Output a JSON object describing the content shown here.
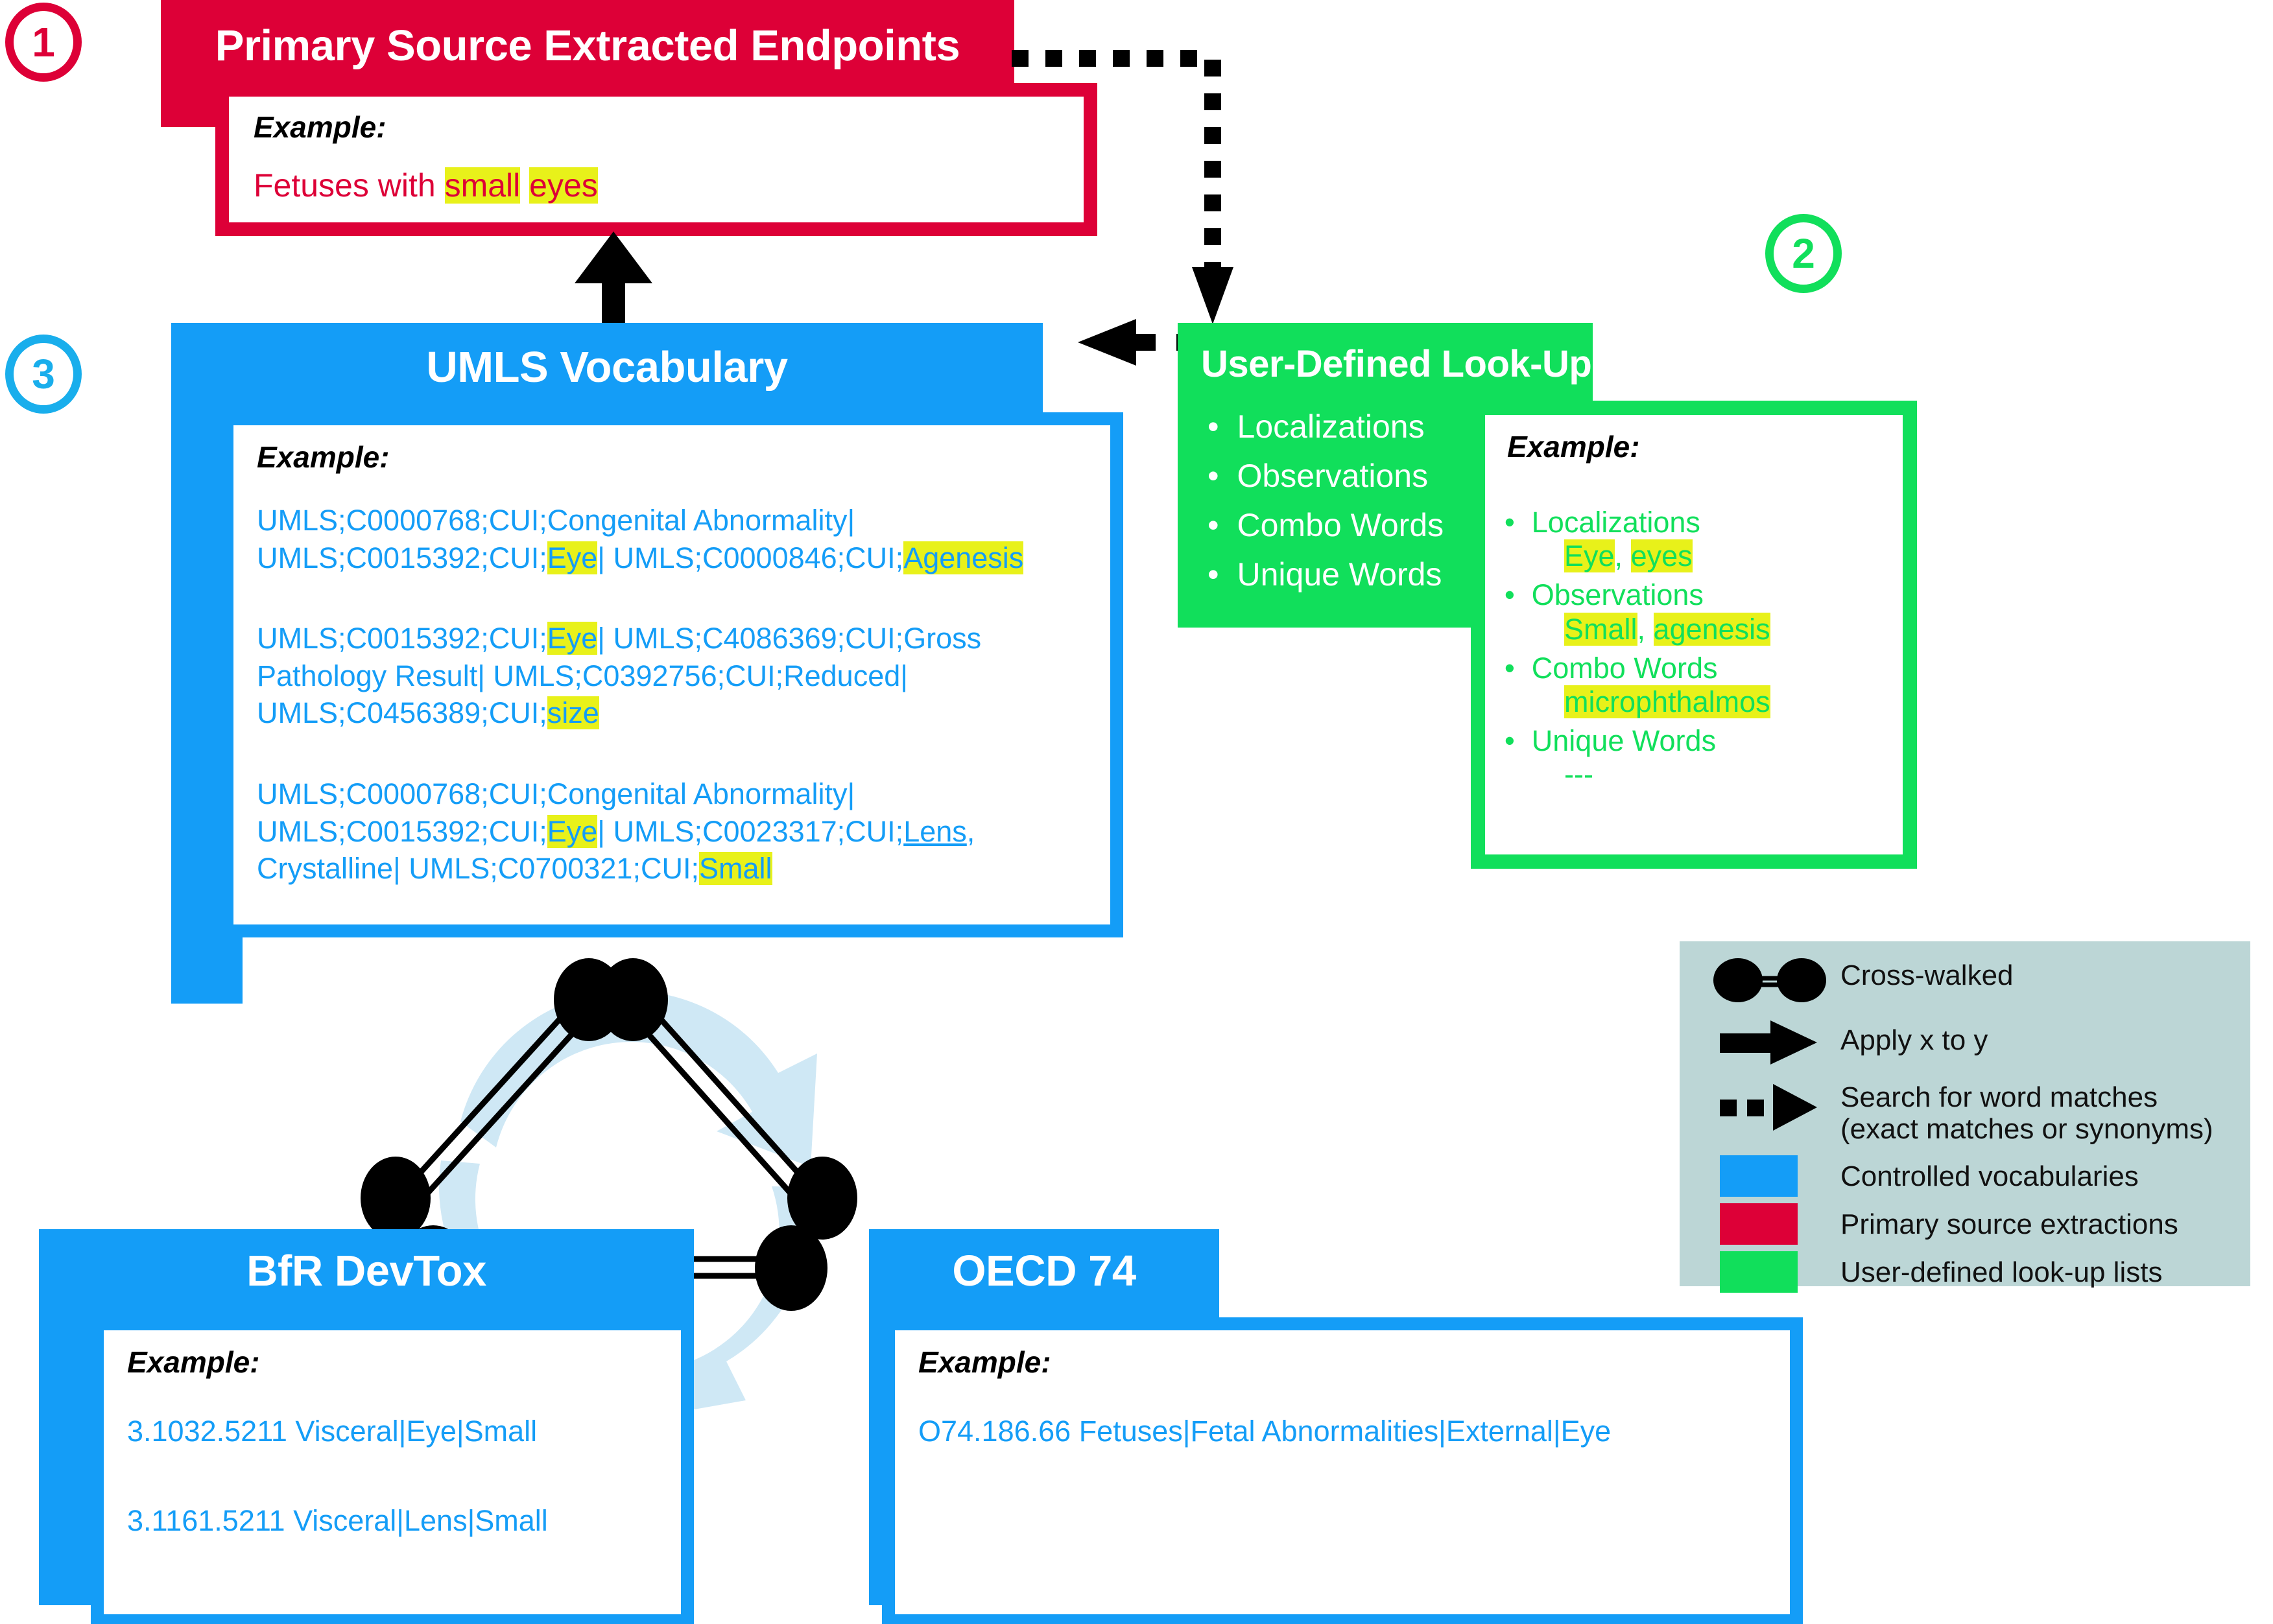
{
  "steps": [
    {
      "num": "1",
      "color": "#DD0037"
    },
    {
      "num": "2",
      "color": "#11DF5B"
    },
    {
      "num": "3",
      "color": "#19AEEC"
    }
  ],
  "colors": {
    "red": "#DD0037",
    "blue": "#149DF7",
    "green": "#11DF5B",
    "highlight": "#E8F11A",
    "legend_bg": "#BCD6D6",
    "cycle_arrow": "#CFE8F5",
    "black": "#000000",
    "white": "#FFFFFF"
  },
  "primary_source": {
    "title": "Primary Source Extracted Endpoints",
    "example_label": "Example:",
    "example_parts": [
      {
        "text": "Fetuses with ",
        "highlight": false
      },
      {
        "text": "small",
        "highlight": true
      },
      {
        "text": " ",
        "highlight": false
      },
      {
        "text": "eyes",
        "highlight": true
      }
    ]
  },
  "umls": {
    "title": "UMLS Vocabulary",
    "example_label": "Example:",
    "entries": [
      [
        {
          "text": "UMLS;C0000768;CUI;Congenital Abnormality| UMLS;C0015392;CUI;",
          "highlight": false
        },
        {
          "text": "Eye",
          "highlight": true
        },
        {
          "text": "| UMLS;C0000846;CUI;",
          "highlight": false
        },
        {
          "text": "Agenesis",
          "highlight": true
        }
      ],
      [
        {
          "text": "UMLS;C0015392;CUI;",
          "highlight": false
        },
        {
          "text": "Eye",
          "highlight": true
        },
        {
          "text": "| UMLS;C4086369;CUI;Gross Pathology Result| UMLS;C0392756;CUI;Reduced| UMLS;C0456389;CUI;",
          "highlight": false
        },
        {
          "text": "size",
          "highlight": true
        }
      ],
      [
        {
          "text": "UMLS;C0000768;CUI;Congenital Abnormality| UMLS;C0015392;CUI;",
          "highlight": false
        },
        {
          "text": "Eye",
          "highlight": true
        },
        {
          "text": "| UMLS;C0023317;CUI;",
          "highlight": false
        },
        {
          "text": "Lens",
          "highlight": false,
          "underline": true
        },
        {
          "text": ", Crystalline| UMLS;C0700321;CUI;",
          "highlight": false
        },
        {
          "text": "Small",
          "highlight": true
        }
      ]
    ]
  },
  "lookup": {
    "title": "User-Defined Look-Up Lists:",
    "bullets": [
      "Localizations",
      "Observations",
      "Combo Words",
      "Unique Words"
    ],
    "example_label": "Example:",
    "example_groups": [
      {
        "label": "Localizations",
        "values": [
          {
            "text": "Eye",
            "highlight": true
          },
          {
            "text": ", ",
            "highlight": false
          },
          {
            "text": "eyes",
            "highlight": true
          }
        ]
      },
      {
        "label": "Observations",
        "values": [
          {
            "text": "Small",
            "highlight": true
          },
          {
            "text": ", ",
            "highlight": false
          },
          {
            "text": "agenesis",
            "highlight": true
          }
        ]
      },
      {
        "label": "Combo Words",
        "values": [
          {
            "text": "microphthalmos",
            "highlight": true
          }
        ]
      },
      {
        "label": "Unique Words",
        "values": [
          {
            "text": "---",
            "highlight": false
          }
        ]
      }
    ]
  },
  "bfr": {
    "title": "BfR DevTox",
    "example_label": "Example:",
    "lines": [
      "3.1032.5211 Visceral|Eye|Small",
      "3.1161.5211 Visceral|Lens|Small"
    ]
  },
  "oecd": {
    "title": "OECD 74",
    "example_label": "Example:",
    "lines": [
      "O74.186.66 Fetuses|Fetal Abnormalities|External|Eye"
    ]
  },
  "legend": {
    "items": [
      {
        "icon": "cross-walked-icon",
        "label": "Cross-walked"
      },
      {
        "icon": "solid-arrow-icon",
        "label": "Apply x to y"
      },
      {
        "icon": "dotted-arrow-icon",
        "label": "Search for word matches (exact matches or synonyms)"
      },
      {
        "icon": "blue-swatch-icon",
        "label": "Controlled vocabularies"
      },
      {
        "icon": "red-swatch-icon",
        "label": "Primary source extractions"
      },
      {
        "icon": "green-swatch-icon",
        "label": "User-defined look-up lists"
      }
    ]
  }
}
